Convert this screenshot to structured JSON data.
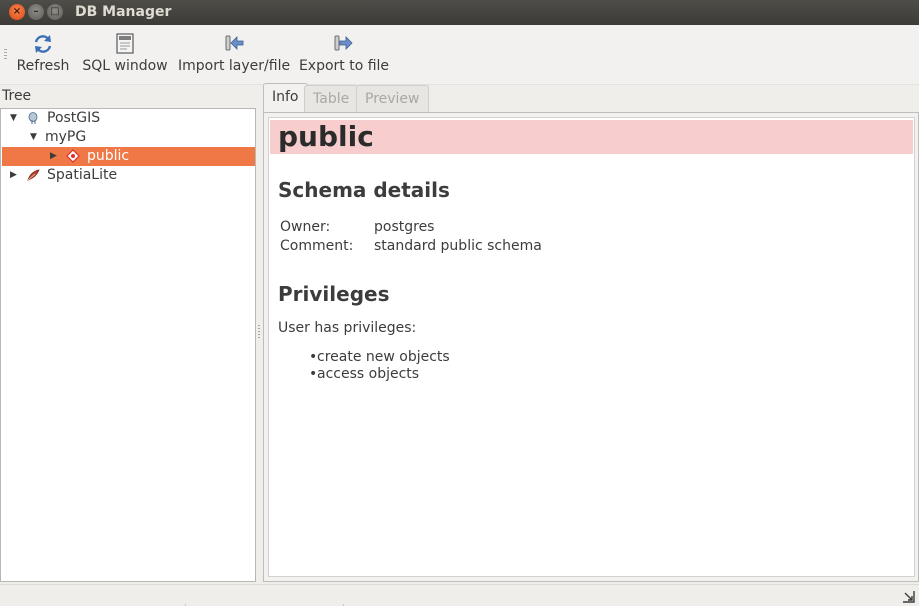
{
  "window": {
    "title": "DB Manager",
    "close_glyph": "×",
    "min_glyph": "–",
    "max_glyph": "□"
  },
  "toolbar": {
    "items": [
      {
        "label": "Refresh",
        "icon": "refresh-icon"
      },
      {
        "label": "SQL window",
        "icon": "sql-window-icon"
      },
      {
        "label": "Import layer/file",
        "icon": "import-icon"
      },
      {
        "label": "Export to file",
        "icon": "export-icon"
      }
    ]
  },
  "tree": {
    "title": "Tree",
    "nodes": [
      {
        "label": "PostGIS",
        "expanded": true,
        "icon": "postgis-elephant-icon"
      },
      {
        "label": "myPG",
        "expanded": true
      },
      {
        "label": "public",
        "expanded": false,
        "selected": true,
        "icon": "schema-icon"
      },
      {
        "label": "SpatiaLite",
        "expanded": false,
        "icon": "spatialite-feather-icon"
      }
    ]
  },
  "tabs": [
    {
      "label": "Info",
      "active": true
    },
    {
      "label": "Table",
      "active": false
    },
    {
      "label": "Preview",
      "active": false
    }
  ],
  "info": {
    "schema_name": "public",
    "details_heading": "Schema details",
    "owner_label": "Owner:",
    "owner_value": "postgres",
    "comment_label": "Comment:",
    "comment_value": "standard public schema",
    "privileges_heading": "Privileges",
    "privileges_intro": "User has privileges:",
    "privileges": [
      "create new objects",
      "access objects"
    ]
  },
  "colors": {
    "selection": "#f07746",
    "title_highlight": "#f8cdcd",
    "titlebar": "#3c3b37"
  }
}
